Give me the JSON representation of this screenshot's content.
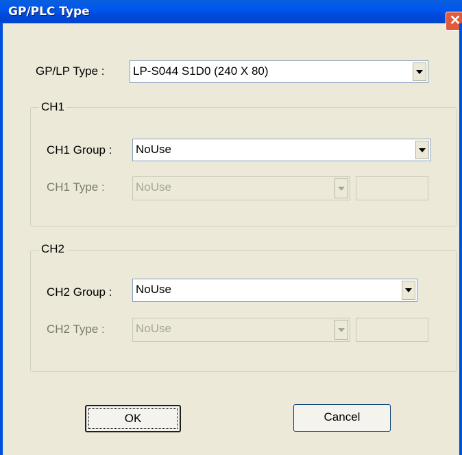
{
  "window": {
    "title": "GP/PLC Type",
    "close_glyph": "✕"
  },
  "gp_lp": {
    "label": "GP/LP Type :",
    "value": "LP-S044  S1D0  (240 X 80)"
  },
  "ch1": {
    "group_label": "CH1",
    "group_field_label": "CH1 Group :",
    "group_value": "NoUse",
    "type_field_label": "CH1 Type :",
    "type_value": "NoUse",
    "extra_value": ""
  },
  "ch2": {
    "group_label": "CH2",
    "group_field_label": "CH2 Group :",
    "group_value": "NoUse",
    "type_field_label": "CH2 Type :",
    "type_value": "NoUse",
    "extra_value": ""
  },
  "buttons": {
    "ok": "OK",
    "cancel": "Cancel"
  }
}
